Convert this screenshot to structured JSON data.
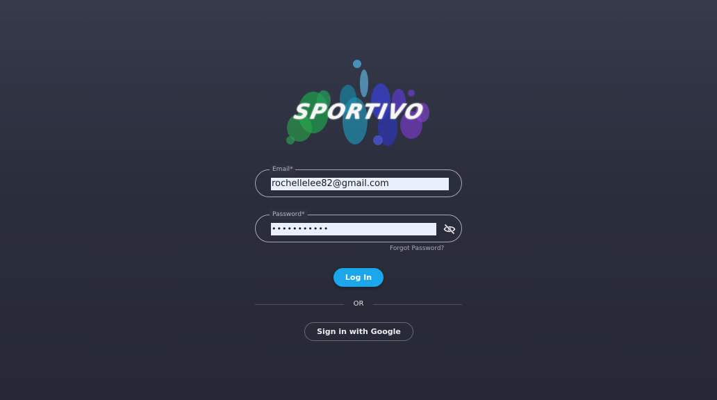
{
  "brand": {
    "logo_text": "SPORTIVO",
    "logo_colors": [
      "#2aa84a",
      "#1f8fb0",
      "#3a3fcf",
      "#7a3ad0",
      "#5fb0d8"
    ]
  },
  "login_form": {
    "email": {
      "label": "Email*",
      "value": "rochellelee82@gmail.com"
    },
    "password": {
      "label": "Password*",
      "value": "•••••••••••",
      "toggle_icon": "eye-slash-icon"
    },
    "forgot_password_label": "Forgot Password?",
    "login_label": "Log In",
    "divider_label": "OR",
    "google_label": "Sign in with Google"
  },
  "colors": {
    "accent": "#1aa7ec",
    "autofill_bg": "#e8f0fe",
    "background_top": "#363a4b",
    "background_bottom": "#262835"
  }
}
